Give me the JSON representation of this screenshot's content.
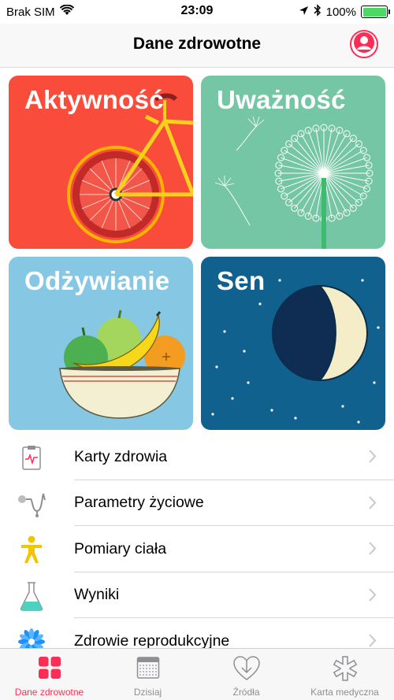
{
  "status_bar": {
    "carrier": "Brak SIM",
    "time": "23:09",
    "battery_percent": "100%",
    "battery_level": 1.0,
    "icons": [
      "wifi-icon",
      "location-arrow-icon",
      "bluetooth-icon",
      "battery-icon"
    ]
  },
  "nav": {
    "title": "Dane zdrowotne",
    "profile_icon": "person-icon"
  },
  "categories": [
    {
      "label": "Aktywność",
      "color": "#fa4c3a"
    },
    {
      "label": "Uważność",
      "color": "#74c6a4"
    },
    {
      "label": "Odżywianie",
      "color": "#86c7e4"
    },
    {
      "label": "Sen",
      "color": "#11618f"
    }
  ],
  "list": [
    {
      "label": "Karty zdrowia",
      "icon": "clipboard-heartbeat-icon"
    },
    {
      "label": "Parametry życiowe",
      "icon": "stethoscope-icon"
    },
    {
      "label": "Pomiary ciała",
      "icon": "body-figure-icon"
    },
    {
      "label": "Wyniki",
      "icon": "lab-flask-icon"
    },
    {
      "label": "Zdrowie reprodukcyjne",
      "icon": "flower-icon"
    }
  ],
  "tabs": [
    {
      "label": "Dane zdrowotne",
      "icon": "grid-icon",
      "active": true
    },
    {
      "label": "Dzisiaj",
      "icon": "calendar-icon",
      "active": false
    },
    {
      "label": "Źródła",
      "icon": "download-heart-icon",
      "active": false
    },
    {
      "label": "Karta medyczna",
      "icon": "medical-asterisk-icon",
      "active": false
    }
  ],
  "colors": {
    "accent": "#ff2d55",
    "chevron": "#c7c7cc",
    "tab_inactive": "#8e8e93"
  }
}
